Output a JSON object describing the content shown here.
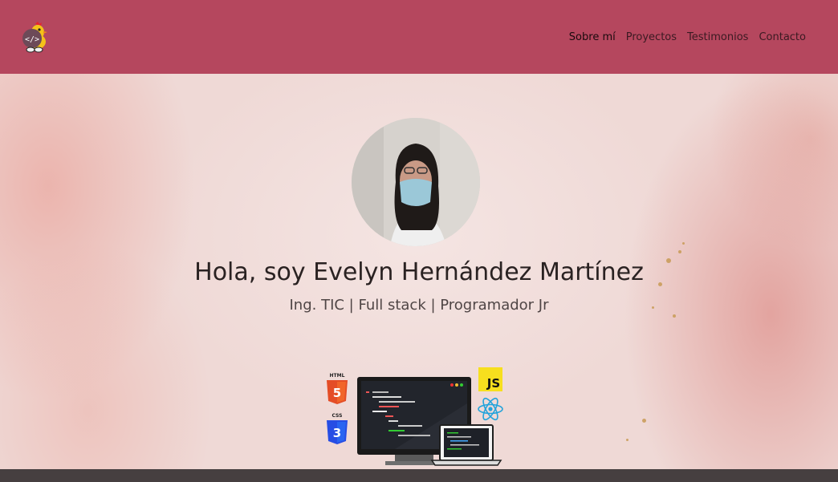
{
  "nav": {
    "logo_icon": "coding-chick-logo-icon",
    "links": [
      "Sobre mí",
      "Proyectos",
      "Testimonios",
      "Contacto"
    ],
    "active_index": 0,
    "background": "#b5475e"
  },
  "hero": {
    "avatar_icon": "profile-photo",
    "title": "Hola, soy Evelyn Hernández Martínez",
    "subtitle": "Ing. TIC | Full stack | Programador Jr",
    "illustration": {
      "html_label": "HTML",
      "html_badge": "5",
      "css_label": "CSS",
      "css_badge": "3",
      "js_label": "JS",
      "icons": [
        "html5-icon",
        "css3-icon",
        "javascript-icon",
        "react-icon",
        "monitor-icon",
        "laptop-icon"
      ]
    }
  }
}
